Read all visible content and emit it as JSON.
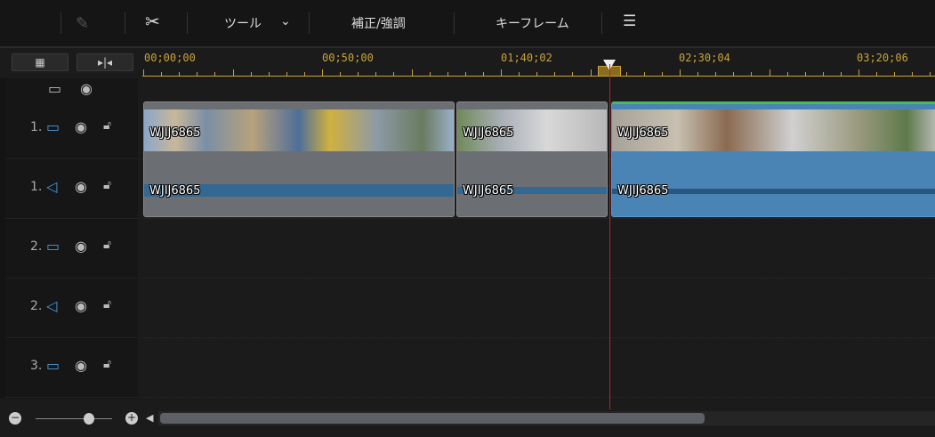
{
  "toolbar": {
    "tools_label": "ツール",
    "correct_label": "補正/強調",
    "keyframe_label": "キーフレーム"
  },
  "ruler": {
    "timecodes": [
      "00;00;00",
      "00;50;00",
      "01;40;02",
      "02;30;04",
      "03;20;06"
    ]
  },
  "tracks": [
    {
      "number": "1.",
      "type": "video"
    },
    {
      "number": "1.",
      "type": "audio"
    },
    {
      "number": "2.",
      "type": "video"
    },
    {
      "number": "2.",
      "type": "audio"
    },
    {
      "number": "3.",
      "type": "video"
    }
  ],
  "clips": [
    {
      "name": "WJIJ6865"
    },
    {
      "name": "WJIJ6865"
    },
    {
      "name": "WJIJ6865"
    }
  ],
  "zoom": {
    "level": 0.7
  },
  "scroll": {
    "position": 0.0,
    "visible_fraction": 0.73
  },
  "colors": {
    "accent": "#c9a23a",
    "playhead": "#c0201e",
    "selected_audio": "#4a84b4"
  }
}
